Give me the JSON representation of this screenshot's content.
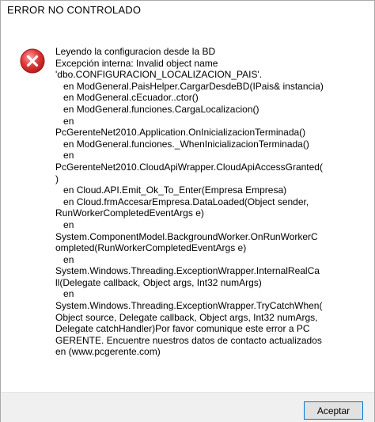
{
  "window": {
    "title": "ERROR NO CONTROLADO"
  },
  "dialog": {
    "icon": "error-icon",
    "message": "Leyendo la configuracion desde la BD\nExcepción interna: Invalid object name\n'dbo.CONFIGURACION_LOCALIZACION_PAIS'.\n   en ModGeneral.PaisHelper.CargarDesdeBD(IPais& instancia)\n   en ModGeneral.cEcuador..ctor()\n   en ModGeneral.funciones.CargaLocalizacion()\n   en\nPcGerenteNet2010.Application.OnInicializacionTerminada()\n   en ModGeneral.funciones._WhenInicializacionTerminada()\n   en\nPcGerenteNet2010.CloudApiWrapper.CloudApiAccessGranted(\n)\n   en Cloud.API.Emit_Ok_To_Enter(Empresa Empresa)\n   en Cloud.frmAccesarEmpresa.DataLoaded(Object sender,\nRunWorkerCompletedEventArgs e)\n   en\nSystem.ComponentModel.BackgroundWorker.OnRunWorkerC\nompleted(RunWorkerCompletedEventArgs e)\n   en\nSystem.Windows.Threading.ExceptionWrapper.InternalRealCa\nll(Delegate callback, Object args, Int32 numArgs)\n   en\nSystem.Windows.Threading.ExceptionWrapper.TryCatchWhen(\nObject source, Delegate callback, Object args, Int32 numArgs,\nDelegate catchHandler)Por favor comunique este error a PC\nGERENTE. Encuentre nuestros datos de contacto actualizados\nen (www.pcgerente.com)"
  },
  "buttons": {
    "accept_label": "Aceptar"
  },
  "colors": {
    "icon_red": "#e03a3a",
    "button_border": "#0078d7",
    "footer_bg": "#f0f0f0"
  }
}
